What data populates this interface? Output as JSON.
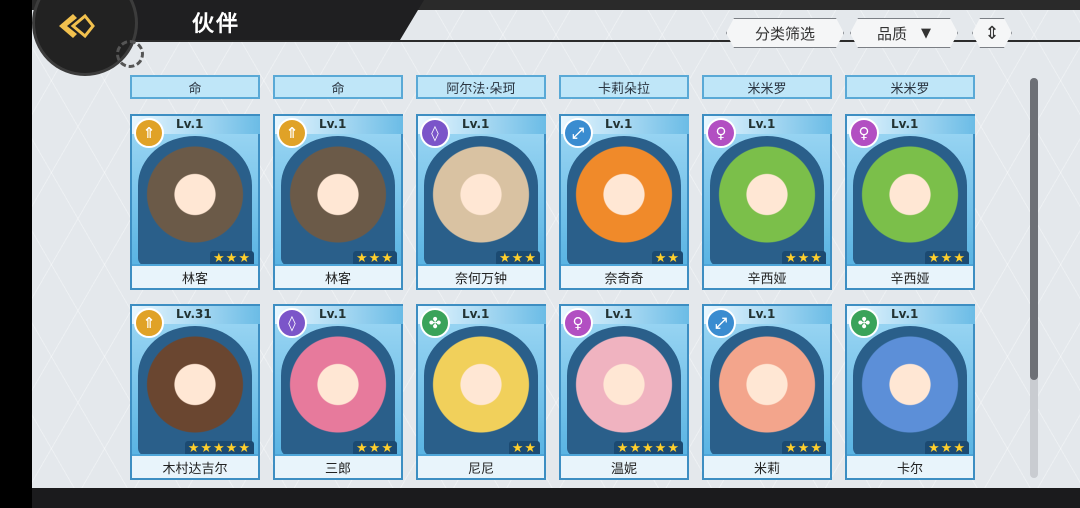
{
  "header": {
    "title": "伙伴",
    "filter_label": "分类筛选",
    "sort_label": "品质",
    "sort_arrow": "▼",
    "order_icon": "⇕"
  },
  "names_row": [
    "命",
    "命",
    "阿尔法·朵珂",
    "卡莉朵拉",
    "米米罗",
    "米米罗"
  ],
  "row1": [
    {
      "level": "Lv.1",
      "name": "林客",
      "stars": "★★★",
      "cls": "sword-icon",
      "glyph": "⇑",
      "color": "#e0a227"
    },
    {
      "level": "Lv.1",
      "name": "林客",
      "stars": "★★★",
      "cls": "sword-icon",
      "glyph": "⇑",
      "color": "#e0a227"
    },
    {
      "level": "Lv.1",
      "name": "奈何万钟",
      "stars": "★★★",
      "cls": "shield-icon",
      "glyph": "◊",
      "color": "#7b55c9"
    },
    {
      "level": "Lv.1",
      "name": "奈奇奇",
      "stars": "★★",
      "cls": "bow-icon",
      "glyph": "⤢",
      "color": "#3a8cd0"
    },
    {
      "level": "Lv.1",
      "name": "辛西娅",
      "stars": "★★★",
      "cls": "magic-icon",
      "glyph": "♀",
      "color": "#b24fc2"
    },
    {
      "level": "Lv.1",
      "name": "辛西娅",
      "stars": "★★★",
      "cls": "magic-icon",
      "glyph": "♀",
      "color": "#b24fc2"
    }
  ],
  "row2": [
    {
      "level": "Lv.31",
      "name": "木村达吉尔",
      "stars": "★★★★★",
      "cls": "sword-icon",
      "glyph": "⇑",
      "color": "#e0a227"
    },
    {
      "level": "Lv.1",
      "name": "三郎",
      "stars": "★★★",
      "cls": "shield-icon",
      "glyph": "◊",
      "color": "#7b55c9"
    },
    {
      "level": "Lv.1",
      "name": "尼尼",
      "stars": "★★",
      "cls": "heal-icon",
      "glyph": "✤",
      "color": "#3aa35a"
    },
    {
      "level": "Lv.1",
      "name": "温妮",
      "stars": "★★★★★",
      "cls": "magic-icon",
      "glyph": "♀",
      "color": "#b24fc2"
    },
    {
      "level": "Lv.1",
      "name": "米莉",
      "stars": "★★★",
      "cls": "bow-icon",
      "glyph": "⤢",
      "color": "#3a8cd0"
    },
    {
      "level": "Lv.1",
      "name": "卡尔",
      "stars": "★★★",
      "cls": "heal-icon",
      "glyph": "✤",
      "color": "#3aa35a"
    }
  ],
  "portraits1": [
    "#6b5a48",
    "#6b5a48",
    "#d9c2a2",
    "#f08a2a",
    "#7bbf4a",
    "#7bbf4a"
  ],
  "portraits2": [
    "#6a4630",
    "#e77a9c",
    "#f1d05b",
    "#f0b3c0",
    "#f3a58c",
    "#5c8fd8"
  ]
}
